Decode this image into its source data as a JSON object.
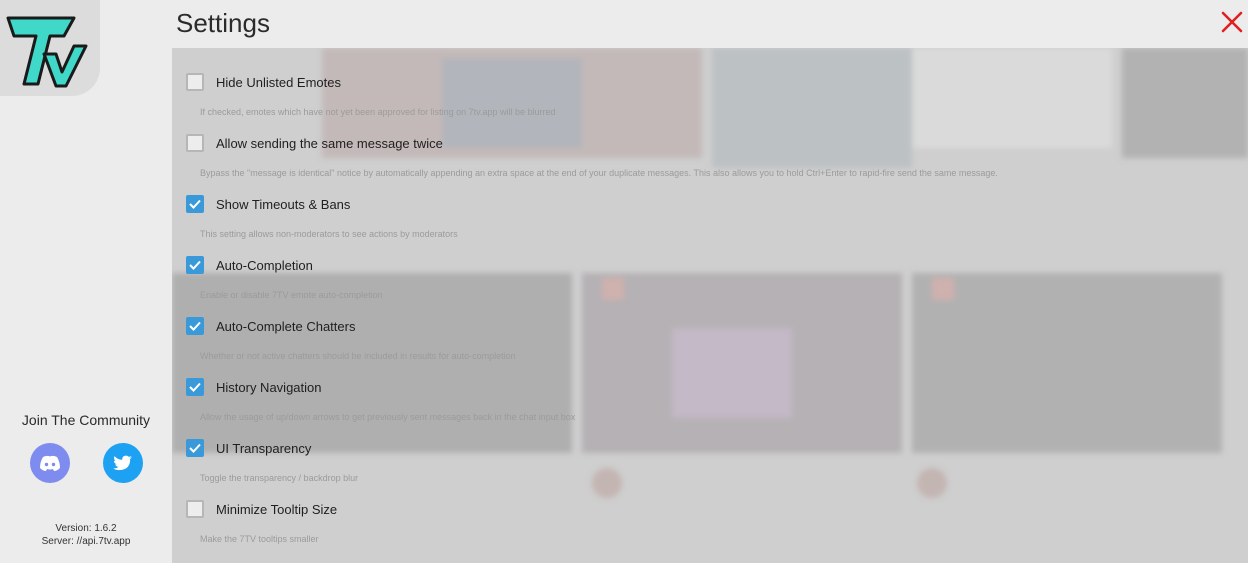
{
  "header": {
    "title": "Settings"
  },
  "sidebar": {
    "community_label": "Join The Community",
    "version_text": "Version: 1.6.2",
    "server_text": "Server: //api.7tv.app",
    "colors": {
      "discord": "#7e8cf0",
      "twitter": "#1da1f2",
      "logo_teal": "#3fd8c9"
    }
  },
  "settings": [
    {
      "label": "Hide Unlisted Emotes",
      "checked": false,
      "description": "If checked, emotes which have not yet been approved for listing on 7tv.app will be blurred"
    },
    {
      "label": "Allow sending the same message twice",
      "checked": false,
      "description": "Bypass the \"message is identical\" notice by automatically appending an extra space at the end of your duplicate messages. This also allows you to hold Ctrl+Enter to rapid-fire send the same message."
    },
    {
      "label": "Show Timeouts & Bans",
      "checked": true,
      "description": "This setting allows non-moderators to see actions by moderators"
    },
    {
      "label": "Auto-Completion",
      "checked": true,
      "description": "Enable or disable 7TV emote auto-completion"
    },
    {
      "label": "Auto-Complete Chatters",
      "checked": true,
      "description": "Whether or not active chatters should be included in results for auto-completion"
    },
    {
      "label": "History Navigation",
      "checked": true,
      "description": "Allow the usage of up/down arrows to get previously sent messages back in the chat input box"
    },
    {
      "label": "UI Transparency",
      "checked": true,
      "description": "Toggle the transparency / backdrop blur"
    },
    {
      "label": "Minimize Tooltip Size",
      "checked": false,
      "description": "Make the 7TV tooltips smaller"
    }
  ],
  "colors": {
    "accent": "#3a9ad9",
    "close": "#e02020"
  }
}
